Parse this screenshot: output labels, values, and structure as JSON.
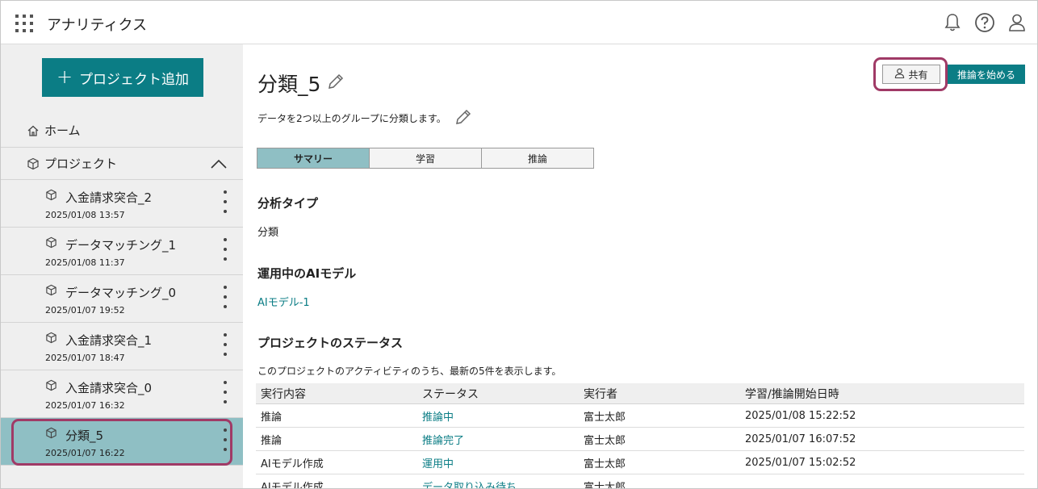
{
  "header": {
    "app_title": "アナリティクス",
    "icons": [
      "apps-grid-icon",
      "bell-icon",
      "help-icon",
      "user-icon"
    ]
  },
  "sidebar": {
    "add_button_label": "プロジェクト追加",
    "home_label": "ホーム",
    "project_label": "プロジェクト",
    "projects": [
      {
        "name": "入金請求突合_2",
        "date": "2025/01/08 13:57"
      },
      {
        "name": "データマッチング_1",
        "date": "2025/01/08 11:37"
      },
      {
        "name": "データマッチング_0",
        "date": "2025/01/07 19:52"
      },
      {
        "name": "入金請求突合_1",
        "date": "2025/01/07 18:47"
      },
      {
        "name": "入金請求突合_0",
        "date": "2025/01/07 16:32"
      },
      {
        "name": "分類_5",
        "date": "2025/01/07 16:22"
      }
    ],
    "selected_index": 5
  },
  "main": {
    "title": "分類_5",
    "description": "データを2つ以上のグループに分類します。",
    "share_label": "共有",
    "start_inference_label": "推論を始める",
    "tabs": [
      "サマリー",
      "学習",
      "推論"
    ],
    "active_tab": 0,
    "analysis_type_heading": "分析タイプ",
    "analysis_type_value": "分類",
    "ai_model_heading": "運用中のAIモデル",
    "ai_model_value": "AIモデル-1",
    "status_heading": "プロジェクトのステータス",
    "status_note": "このプロジェクトのアクティビティのうち、最新の5件を表示します。",
    "table": {
      "columns": [
        "実行内容",
        "ステータス",
        "実行者",
        "学習/推論開始日時"
      ],
      "rows": [
        [
          "推論",
          "推論中",
          "富士太郎",
          "2025/01/08 15:22:52"
        ],
        [
          "推論",
          "推論完了",
          "富士太郎",
          "2025/01/07 16:07:52"
        ],
        [
          "AIモデル作成",
          "運用中",
          "富士太郎",
          "2025/01/07 15:02:52"
        ],
        [
          "AIモデル作成",
          "データ取り込み待ち",
          "富士太郎",
          ""
        ]
      ]
    }
  },
  "colors": {
    "accent": "#0b7d85",
    "selected": "#8fbfc4",
    "highlight": "#a03a66"
  }
}
